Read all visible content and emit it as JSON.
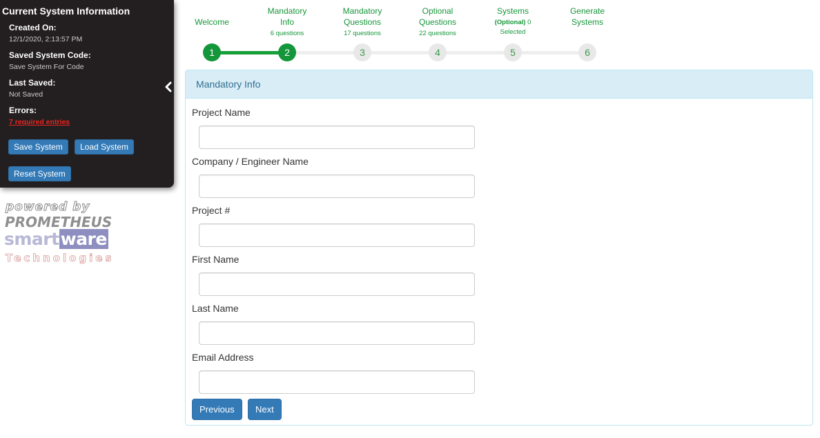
{
  "info_panel": {
    "title": "Current System Information",
    "created_label": "Created On:",
    "created_value": "12/1/2020, 2:13:57 PM",
    "code_label": "Saved System Code:",
    "code_value": "Save System For Code",
    "saved_label": "Last Saved:",
    "saved_value": "Not Saved",
    "errors_label": "Errors:",
    "errors_value": "7 required entries",
    "save_button": "Save System",
    "load_button": "Load System",
    "reset_button": "Reset System",
    "collapse_icon": "chevron-left-icon"
  },
  "logo": {
    "line1": "powered by",
    "line2": "PROMETHEUS",
    "line3a": "smart",
    "line3b": "ware",
    "line4": "Technologies"
  },
  "steps": [
    {
      "title": "Welcome",
      "sub": "",
      "number": "1",
      "status": "done"
    },
    {
      "title": "Mandatory Info",
      "sub": "6 questions",
      "number": "2",
      "status": "done"
    },
    {
      "title": "Mandatory Questions",
      "sub": "17 questions",
      "number": "3",
      "status": "todo"
    },
    {
      "title": "Optional Questions",
      "sub": "22 questions",
      "number": "4",
      "status": "todo"
    },
    {
      "title": "Systems",
      "sub_bold": "(Optional)",
      "sub": "0",
      "sub2": "Selected",
      "number": "5",
      "status": "todo"
    },
    {
      "title": "Generate Systems",
      "sub": "",
      "number": "6",
      "status": "todo"
    }
  ],
  "form": {
    "header": "Mandatory Info",
    "fields": [
      {
        "label": "Project Name",
        "value": ""
      },
      {
        "label": "Company / Engineer Name",
        "value": ""
      },
      {
        "label": "Project #",
        "value": ""
      },
      {
        "label": "First Name",
        "value": ""
      },
      {
        "label": "Last Name",
        "value": ""
      },
      {
        "label": "Email Address",
        "value": ""
      }
    ],
    "previous_button": "Previous",
    "next_button": "Next"
  },
  "colors": {
    "panel_bg": "#231f20",
    "primary_button": "#337ab7",
    "step_green": "#17a03a",
    "error_red": "#e8231f",
    "header_bg": "#d9edf7"
  }
}
